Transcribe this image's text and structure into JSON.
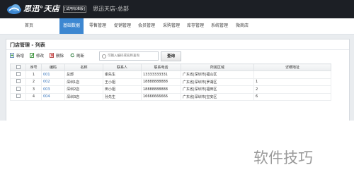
{
  "app": {
    "logo_text": "思迅°天店",
    "edition": "[试用标准版]",
    "store_name": "思迅天店-总部"
  },
  "nav": {
    "items": [
      {
        "label": "首页"
      },
      {
        "label": "基础数据",
        "active": true
      },
      {
        "label": "零售管理"
      },
      {
        "label": "促销管理"
      },
      {
        "label": "会员管理"
      },
      {
        "label": "采购管理"
      },
      {
        "label": "库存管理"
      },
      {
        "label": "系统管理"
      },
      {
        "label": "微商店"
      }
    ]
  },
  "panel": {
    "title": "门店管理 - 列表"
  },
  "toolbar": {
    "add": "新增",
    "edit": "修改",
    "delete": "删除",
    "refresh": "刷新",
    "search_placeholder": "可输入编码或名称查询",
    "query": "查询"
  },
  "table": {
    "headers": [
      "",
      "序号",
      "编码",
      "名称",
      "联系人",
      "联系电话",
      "所属区域",
      "详细地址"
    ],
    "rows": [
      {
        "seq": "1",
        "code": "001",
        "name": "总部",
        "contact": "谢先生",
        "phone": "13333333331",
        "region": "广东省|深圳市|福山区",
        "address": ""
      },
      {
        "seq": "2",
        "code": "002",
        "name": "深圳1店",
        "contact": "王小姐",
        "phone": "18888888888",
        "region": "广东省|深圳市|罗湖区",
        "address": "1"
      },
      {
        "seq": "3",
        "code": "003",
        "name": "深圳2店",
        "contact": "田小姐",
        "phone": "18888888888",
        "region": "广东省|深圳市|福田区",
        "address": "2"
      },
      {
        "seq": "4",
        "code": "004",
        "name": "深圳3店",
        "contact": "孙先生",
        "phone": "16666666666",
        "region": "广东省|深圳市|宝安区",
        "address": "6"
      }
    ]
  },
  "watermark": "软件技巧",
  "colors": {
    "topbar": "#1c1f25",
    "active_nav": "#3d87d1",
    "link": "#2f6fb8"
  },
  "icons": {
    "add": "add-doc-icon",
    "edit": "edit-icon",
    "delete": "delete-icon",
    "refresh": "refresh-icon",
    "search": "search-icon"
  }
}
